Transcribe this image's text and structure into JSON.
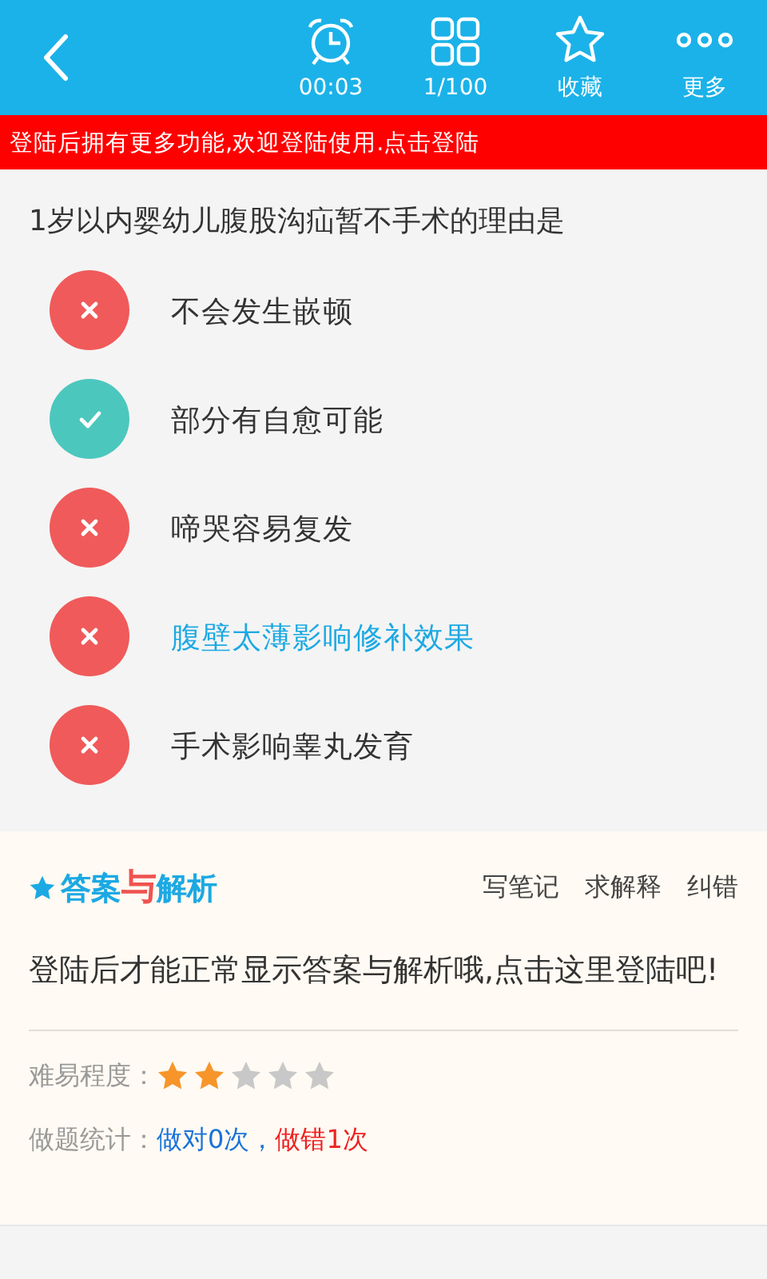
{
  "toolbar": {
    "items": [
      {
        "kind": "timer",
        "label": "00:03"
      },
      {
        "kind": "grid",
        "label": "1/100"
      },
      {
        "kind": "star",
        "label": "收藏"
      },
      {
        "kind": "more",
        "label": "更多"
      }
    ]
  },
  "login_banner": "登陆后拥有更多功能,欢迎登陆使用.点击登陆",
  "question": "1岁以内婴幼儿腹股沟疝暂不手术的理由是",
  "options": [
    {
      "kind": "wrong",
      "text": "不会发生嵌顿",
      "selected": false
    },
    {
      "kind": "right",
      "text": "部分有自愈可能",
      "selected": false
    },
    {
      "kind": "wrong",
      "text": "啼哭容易复发",
      "selected": false
    },
    {
      "kind": "wrong",
      "text": "腹壁太薄影响修补效果",
      "selected": true
    },
    {
      "kind": "wrong",
      "text": "手术影响睾丸发育",
      "selected": false
    }
  ],
  "analysis": {
    "title_parts": [
      "答案",
      "与",
      "解析"
    ],
    "actions": [
      "写笔记",
      "求解释",
      "纠错"
    ],
    "message": "登陆后才能正常显示答案与解析哦,点击这里登陆吧!",
    "difficulty": {
      "label": "难易程度：",
      "stars": 2
    },
    "stats": {
      "label": "做题统计：",
      "right": "做对0次",
      "separator": "，",
      "wrong": "做错1次"
    }
  }
}
